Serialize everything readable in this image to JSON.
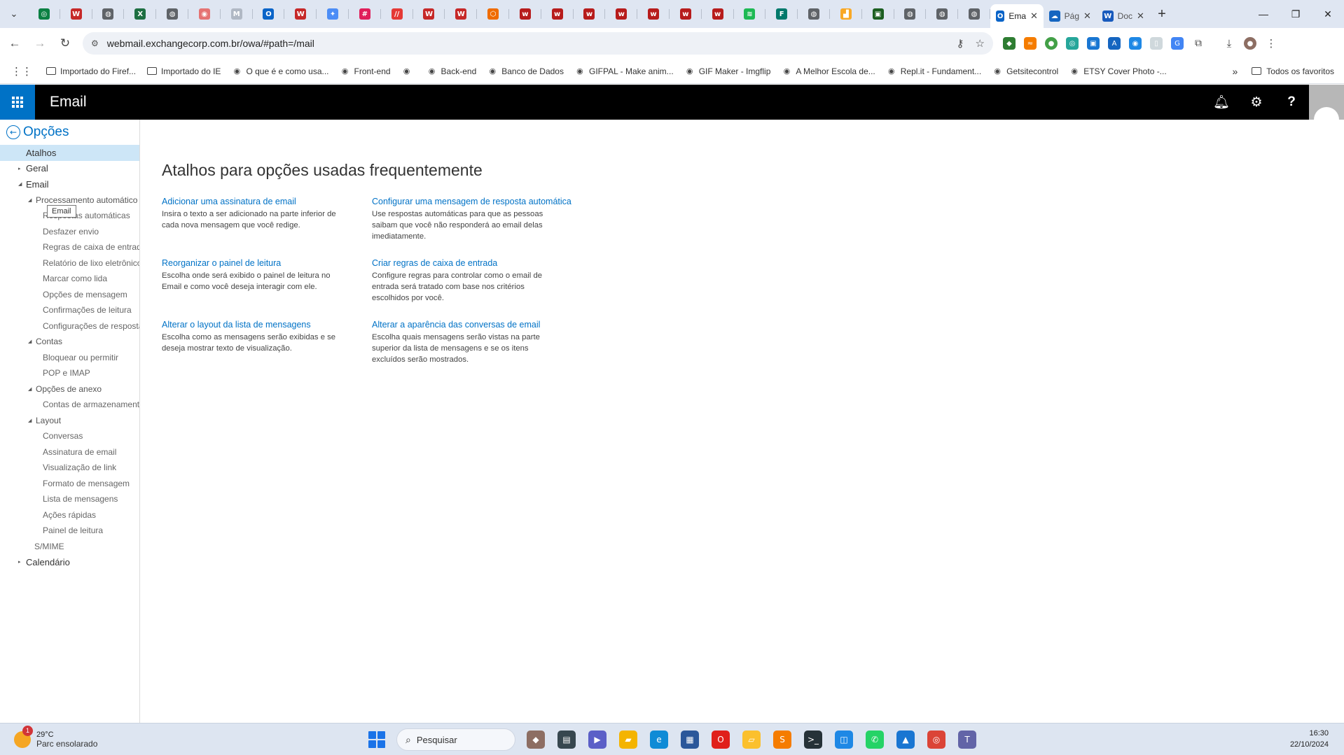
{
  "browser": {
    "mini_tabs": [
      {
        "icon": "chrome-tab-icon",
        "color": "#0b8043",
        "glyph": "◎"
      },
      {
        "icon": "word-w-icon",
        "color": "#c62828",
        "glyph": "W"
      },
      {
        "icon": "globe-icon",
        "color": "#5f6368",
        "glyph": "◍"
      },
      {
        "icon": "excel-icon",
        "color": "#1d6f42",
        "glyph": "X"
      },
      {
        "icon": "globe-icon",
        "color": "#5f6368",
        "glyph": "◍"
      },
      {
        "icon": "red-circle-icon",
        "color": "#e57373",
        "glyph": "◉"
      },
      {
        "icon": "gmail-icon",
        "color": "#b0b8c4",
        "glyph": "M"
      },
      {
        "icon": "outlook-icon",
        "color": "#0a64c8",
        "glyph": "O"
      },
      {
        "icon": "word-w-icon",
        "color": "#c62828",
        "glyph": "W"
      },
      {
        "icon": "gemini-star-icon",
        "color": "#4c8df6",
        "glyph": "✦"
      },
      {
        "icon": "slack-icon",
        "color": "#e01e5a",
        "glyph": "#"
      },
      {
        "icon": "stripes-icon",
        "color": "#e53935",
        "glyph": "//"
      },
      {
        "icon": "word-w-icon",
        "color": "#c62828",
        "glyph": "W"
      },
      {
        "icon": "word-w-icon",
        "color": "#c62828",
        "glyph": "W"
      },
      {
        "icon": "orange-hex-icon",
        "color": "#ef6c00",
        "glyph": "⬡"
      },
      {
        "icon": "w-script-icon",
        "color": "#b71c1c",
        "glyph": "w"
      },
      {
        "icon": "w-script-icon",
        "color": "#b71c1c",
        "glyph": "w"
      },
      {
        "icon": "w-script-icon",
        "color": "#b71c1c",
        "glyph": "w"
      },
      {
        "icon": "w-script-icon",
        "color": "#b71c1c",
        "glyph": "w"
      },
      {
        "icon": "w-script-icon",
        "color": "#b71c1c",
        "glyph": "w"
      },
      {
        "icon": "w-script-icon",
        "color": "#b71c1c",
        "glyph": "w"
      },
      {
        "icon": "w-script-icon",
        "color": "#b71c1c",
        "glyph": "w"
      },
      {
        "icon": "spotify-icon",
        "color": "#1db954",
        "glyph": "≋"
      },
      {
        "icon": "teal-form-icon",
        "color": "#00796b",
        "glyph": "F"
      },
      {
        "icon": "globe-icon",
        "color": "#5f6368",
        "glyph": "◍"
      },
      {
        "icon": "yellow-chart-icon",
        "color": "#f9a825",
        "glyph": "▟"
      },
      {
        "icon": "green-square-icon",
        "color": "#1b5e20",
        "glyph": "▣"
      },
      {
        "icon": "globe-icon",
        "color": "#5f6368",
        "glyph": "◍"
      },
      {
        "icon": "globe-icon",
        "color": "#5f6368",
        "glyph": "◍"
      },
      {
        "icon": "globe-icon",
        "color": "#5f6368",
        "glyph": "◍"
      }
    ],
    "named_tabs": [
      {
        "title": "Ema",
        "icon": "outlook-icon",
        "color": "#0a64c8",
        "glyph": "O",
        "active": true
      },
      {
        "title": "Pág",
        "icon": "onedrive-cloud-icon",
        "color": "#1565c0",
        "glyph": "☁",
        "active": false
      },
      {
        "title": "Doc",
        "icon": "word-icon",
        "color": "#185abd",
        "glyph": "W",
        "active": false
      }
    ],
    "url": "webmail.exchangecorp.com.br/owa/#path=/mail",
    "bookmarks": [
      {
        "label": "Importado do Firef...",
        "icon": "folder-icon"
      },
      {
        "label": "Importado do IE",
        "icon": "folder-icon"
      },
      {
        "label": "O que é e como usa...",
        "icon": "hd-icon"
      },
      {
        "label": "Front-end",
        "icon": "coffee-icon"
      },
      {
        "label": "",
        "icon": "globe-icon"
      },
      {
        "label": "Back-end",
        "icon": "notion-icon"
      },
      {
        "label": "Banco de Dados",
        "icon": "notion-icon"
      },
      {
        "label": "GIFPAL - Make anim...",
        "icon": "gifpal-icon"
      },
      {
        "label": "GIF Maker - Imgflip",
        "icon": "imgflip-icon"
      },
      {
        "label": "A Melhor Escola de...",
        "icon": "alura-icon"
      },
      {
        "label": "Repl.it - Fundament...",
        "icon": "replit-icon"
      },
      {
        "label": "Getsitecontrol",
        "icon": "getsitecontrol-icon"
      },
      {
        "label": "ETSY Cover Photo -...",
        "icon": "etsy-icon"
      }
    ],
    "all_bookmarks": "Todos os favoritos"
  },
  "owa": {
    "app_title": "Email",
    "back_label": "Opções",
    "tooltip": "Email",
    "nav": [
      {
        "label": "Atalhos",
        "level": "l0",
        "caret": "",
        "selected": true
      },
      {
        "label": "Geral",
        "level": "l0a",
        "caret": "▸",
        "selected": false
      },
      {
        "label": "Email",
        "level": "l0a",
        "caret": "◢",
        "selected": false
      },
      {
        "label": "Processamento automático",
        "level": "l1",
        "caret": "◢",
        "selected": false
      },
      {
        "label": "Respostas automáticas",
        "level": "l2",
        "caret": "",
        "selected": false
      },
      {
        "label": "Desfazer envio",
        "level": "l2",
        "caret": "",
        "selected": false
      },
      {
        "label": "Regras de caixa de entrada",
        "level": "l2",
        "caret": "",
        "selected": false
      },
      {
        "label": "Relatório de lixo eletrônico",
        "level": "l2",
        "caret": "",
        "selected": false
      },
      {
        "label": "Marcar como lida",
        "level": "l2",
        "caret": "",
        "selected": false
      },
      {
        "label": "Opções de mensagem",
        "level": "l2",
        "caret": "",
        "selected": false
      },
      {
        "label": "Confirmações de leitura",
        "level": "l2",
        "caret": "",
        "selected": false
      },
      {
        "label": "Configurações de resposta",
        "level": "l2",
        "caret": "",
        "selected": false
      },
      {
        "label": "Contas",
        "level": "l1",
        "caret": "◢",
        "selected": false
      },
      {
        "label": "Bloquear ou permitir",
        "level": "l2",
        "caret": "",
        "selected": false
      },
      {
        "label": "POP e IMAP",
        "level": "l2",
        "caret": "",
        "selected": false
      },
      {
        "label": "Opções de anexo",
        "level": "l1",
        "caret": "◢",
        "selected": false
      },
      {
        "label": "Contas de armazenamento",
        "level": "l2",
        "caret": "",
        "selected": false
      },
      {
        "label": "Layout",
        "level": "l1",
        "caret": "◢",
        "selected": false
      },
      {
        "label": "Conversas",
        "level": "l2",
        "caret": "",
        "selected": false
      },
      {
        "label": "Assinatura de email",
        "level": "l2",
        "caret": "",
        "selected": false
      },
      {
        "label": "Visualização de link",
        "level": "l2",
        "caret": "",
        "selected": false
      },
      {
        "label": "Formato de mensagem",
        "level": "l2",
        "caret": "",
        "selected": false
      },
      {
        "label": "Lista de mensagens",
        "level": "l2",
        "caret": "",
        "selected": false
      },
      {
        "label": "Ações rápidas",
        "level": "l2",
        "caret": "",
        "selected": false
      },
      {
        "label": "Painel de leitura",
        "level": "l2",
        "caret": "",
        "selected": false
      },
      {
        "label": "S/MIME",
        "level": "l1n",
        "caret": "",
        "selected": false
      },
      {
        "label": "Calendário",
        "level": "l0a",
        "caret": "▸",
        "selected": false
      }
    ],
    "page_title": "Atalhos para opções usadas frequentemente",
    "shortcuts": [
      {
        "link": "Adicionar uma assinatura de email",
        "desc": "Insira o texto a ser adicionado na parte inferior de cada nova mensagem que você redige."
      },
      {
        "link": "Configurar uma mensagem de resposta automática",
        "desc": "Use respostas automáticas para que as pessoas saibam que você não responderá ao email delas imediatamente."
      },
      {
        "link": "Reorganizar o painel de leitura",
        "desc": "Escolha onde será exibido o painel de leitura no Email e como você deseja interagir com ele."
      },
      {
        "link": "Criar regras de caixa de entrada",
        "desc": "Configure regras para controlar como o email de entrada será tratado com base nos critérios escolhidos por você."
      },
      {
        "link": "Alterar o layout da lista de mensagens",
        "desc": "Escolha como as mensagens serão exibidas e se deseja mostrar texto de visualização."
      },
      {
        "link": "Alterar a aparência das conversas de email",
        "desc": "Escolha quais mensagens serão vistas na parte superior da lista de mensagens e se os itens excluídos serão mostrados."
      }
    ]
  },
  "taskbar": {
    "weather_badge": "1",
    "temperature": "29°C",
    "condition": "Parc ensolarado",
    "search_placeholder": "Pesquisar",
    "apps": [
      {
        "icon": "wombat-widget-icon",
        "color": "#8d6e63",
        "glyph": "◆"
      },
      {
        "icon": "task-view-icon",
        "color": "#37474f",
        "glyph": "▤"
      },
      {
        "icon": "teams-meet-icon",
        "color": "#5b5fc7",
        "glyph": "▶"
      },
      {
        "icon": "file-explorer-icon",
        "color": "#f4b400",
        "glyph": "▰"
      },
      {
        "icon": "edge-icon",
        "color": "#0f8bd6",
        "glyph": "e"
      },
      {
        "icon": "store-icon",
        "color": "#2b579a",
        "glyph": "▦"
      },
      {
        "icon": "opera-icon",
        "color": "#e0201b",
        "glyph": "O"
      },
      {
        "icon": "sticky-notes-icon",
        "color": "#fbc02d",
        "glyph": "▱"
      },
      {
        "icon": "sublime-icon",
        "color": "#f57c00",
        "glyph": "S"
      },
      {
        "icon": "terminal-icon",
        "color": "#263238",
        "glyph": ">_"
      },
      {
        "icon": "remote-app-icon",
        "color": "#1e88e5",
        "glyph": "◫"
      },
      {
        "icon": "whatsapp-icon",
        "color": "#25d366",
        "glyph": "✆"
      },
      {
        "icon": "photos-icon",
        "color": "#1976d2",
        "glyph": "▲"
      },
      {
        "icon": "chrome-icon",
        "color": "#db4437",
        "glyph": "◎"
      },
      {
        "icon": "teams-icon",
        "color": "#6264a7",
        "glyph": "T"
      }
    ],
    "time": "16:30",
    "date": "22/10/2024"
  }
}
